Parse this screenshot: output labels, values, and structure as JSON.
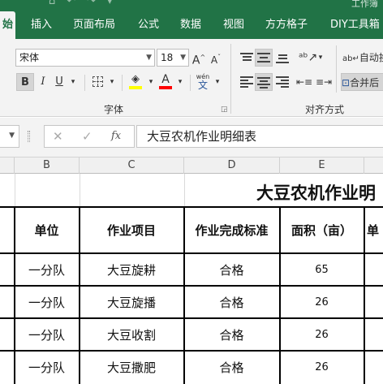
{
  "ribbon_tabs": {
    "home": "始",
    "insert": "插入",
    "page_layout": "页面布局",
    "formulas": "公式",
    "data": "数据",
    "view": "视图",
    "fangfang": "方方格子",
    "diy": "DIY工具箱"
  },
  "font": {
    "family": "宋体",
    "size": "18",
    "bold": "B",
    "italic": "I",
    "underline": "U",
    "font_color_glyph": "A",
    "highlight_color": "#ffff00",
    "font_color": "#ff0000",
    "phonetic": "wén"
  },
  "groups": {
    "font_label": "字体",
    "alignment_label": "对齐方式"
  },
  "alignment": {
    "wrap_text": "自动换",
    "merge": "合并后"
  },
  "formula_bar": {
    "cancel": "✕",
    "enter": "✓",
    "fx": "fx",
    "content": "大豆农机作业明细表"
  },
  "columns": [
    "B",
    "C",
    "D",
    "E"
  ],
  "sheet": {
    "title": "大豆农机作业明",
    "headers": [
      "单位",
      "作业项目",
      "作业完成标准",
      "面积（亩）",
      "单"
    ],
    "rows": [
      {
        "unit": "一分队",
        "task": "大豆旋耕",
        "standard": "合格",
        "area": "65"
      },
      {
        "unit": "一分队",
        "task": "大豆旋播",
        "standard": "合格",
        "area": "26"
      },
      {
        "unit": "一分队",
        "task": "大豆收割",
        "standard": "合格",
        "area": "26"
      },
      {
        "unit": "一分队",
        "task": "大豆撒肥",
        "standard": "合格",
        "area": "26"
      }
    ]
  },
  "colors": {
    "excel_green": "#217346",
    "ribbon_bg": "#f3f3f3"
  }
}
